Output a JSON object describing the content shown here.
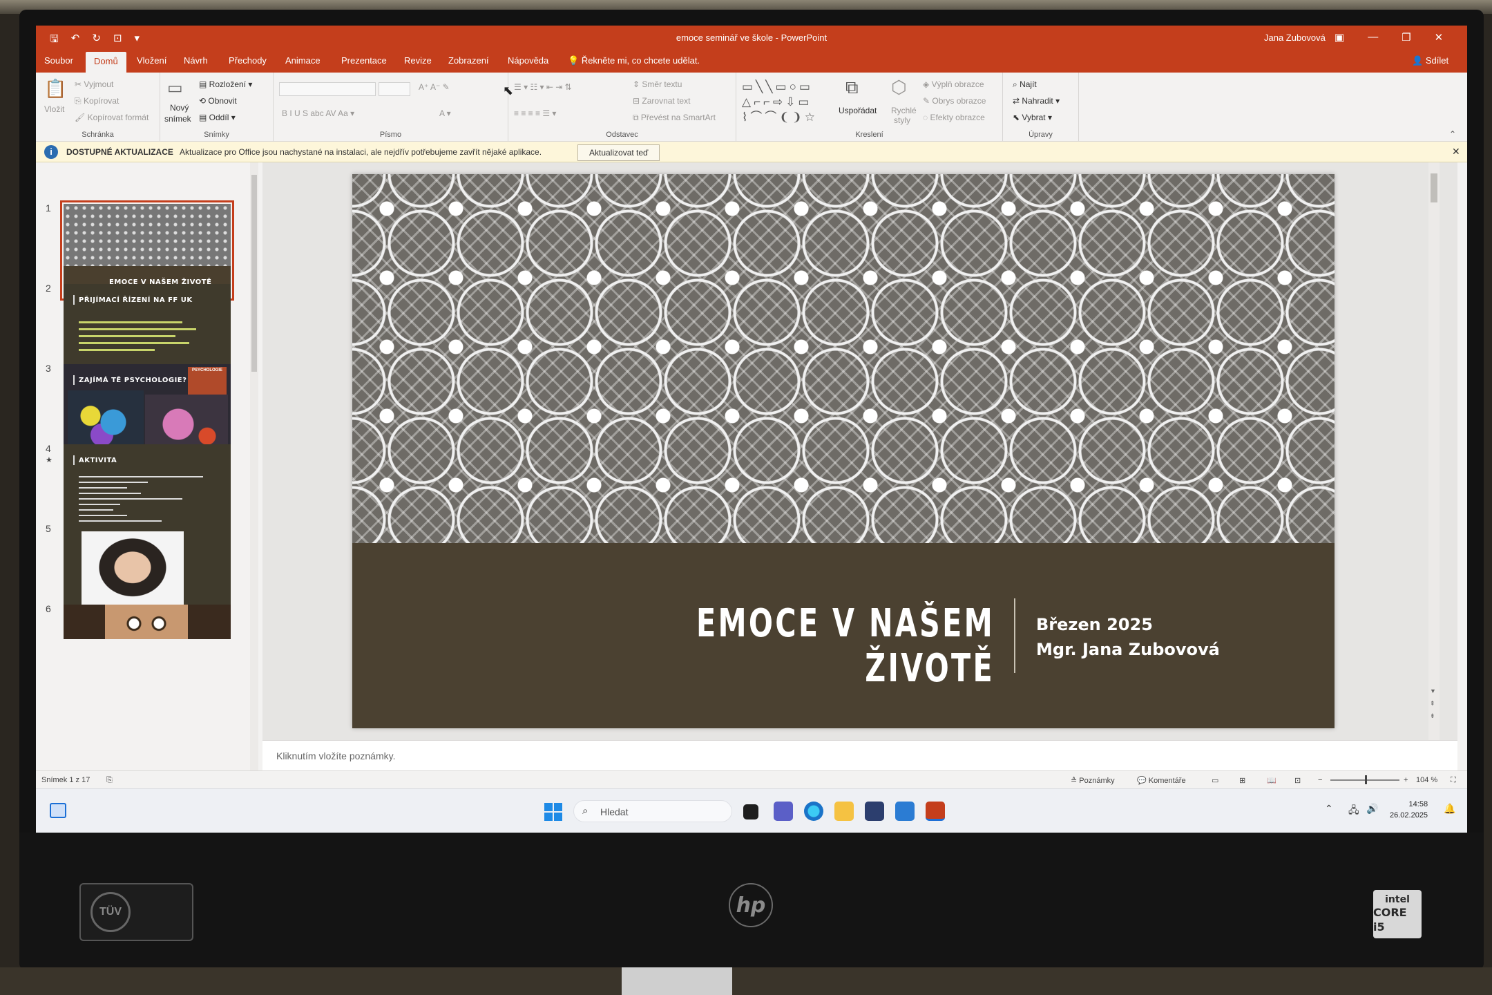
{
  "window": {
    "title": "emoce seminář ve škole - PowerPoint",
    "user": "Jana Zubovová"
  },
  "tabs": [
    "Soubor",
    "Domů",
    "Vložení",
    "Návrh",
    "Přechody",
    "Animace",
    "Prezentace",
    "Revize",
    "Zobrazení",
    "Nápověda"
  ],
  "active_tab": "Domů",
  "tell_me": "Řekněte mi, co chcete udělat.",
  "share_label": "Sdílet",
  "ribbon": {
    "clipboard": {
      "name": "Schránka",
      "paste": "Vložit",
      "cut": "Vyjmout",
      "copy": "Kopírovat",
      "format_painter": "Kopírovat formát"
    },
    "slides": {
      "name": "Snímky",
      "new_slide_1": "Nový",
      "new_slide_2": "snímek",
      "layout": "Rozložení",
      "reset": "Obnovit",
      "section": "Oddíl"
    },
    "font": {
      "name": "Písmo"
    },
    "paragraph": {
      "name": "Odstavec",
      "text_direction": "Směr textu",
      "align_text": "Zarovnat text",
      "smartart": "Převést na SmartArt"
    },
    "drawing": {
      "name": "Kreslení",
      "arrange": "Uspořádat",
      "quick_styles_1": "Rychlé",
      "quick_styles_2": "styly",
      "shape_fill": "Výplň obrazce",
      "shape_outline": "Obrys obrazce",
      "shape_effects": "Efekty obrazce"
    },
    "editing": {
      "name": "Úpravy",
      "find": "Najít",
      "replace": "Nahradit",
      "select": "Vybrat"
    }
  },
  "infobar": {
    "heading": "DOSTUPNÉ AKTUALIZACE",
    "message": "Aktualizace pro Office jsou nachystané na instalaci, ale nejdřív potřebujeme zavřít nějaké aplikace.",
    "button": "Aktualizovat teď"
  },
  "thumbnails": [
    {
      "num": "1",
      "title": "EMOCE V NAŠEM ŽIVOTĚ",
      "selected": true
    },
    {
      "num": "2",
      "title": "PŘIJÍMACÍ ŘÍZENÍ NA FF UK"
    },
    {
      "num": "3",
      "title": "ZAJÍMÁ TĚ PSYCHOLOGIE?",
      "badge": "PSYCHOLOGIE"
    },
    {
      "num": "4",
      "title": "AKTIVITA"
    },
    {
      "num": "5",
      "title": ""
    },
    {
      "num": "6",
      "title": ""
    }
  ],
  "slide": {
    "title": "EMOCE V NAŠEM ŽIVOTĚ",
    "date": "Březen 2025",
    "author": "Mgr. Jana Zubovová",
    "pattern_color": "#6e6b66",
    "band_color": "#4b4131"
  },
  "notes_placeholder": "Kliknutím vložíte poznámky.",
  "status": {
    "slide_counter": "Snímek 1 z 17",
    "notes": "Poznámky",
    "comments": "Komentáře",
    "zoom": "104 %"
  },
  "taskbar": {
    "search_placeholder": "Hledat",
    "time": "14:58",
    "date": "26.02.2025"
  },
  "hardware": {
    "brand": "hp",
    "cert": "TÜV",
    "cpu_1": "intel",
    "cpu_2": "CORE i5"
  },
  "colors": {
    "accent": "#c43e1c"
  }
}
